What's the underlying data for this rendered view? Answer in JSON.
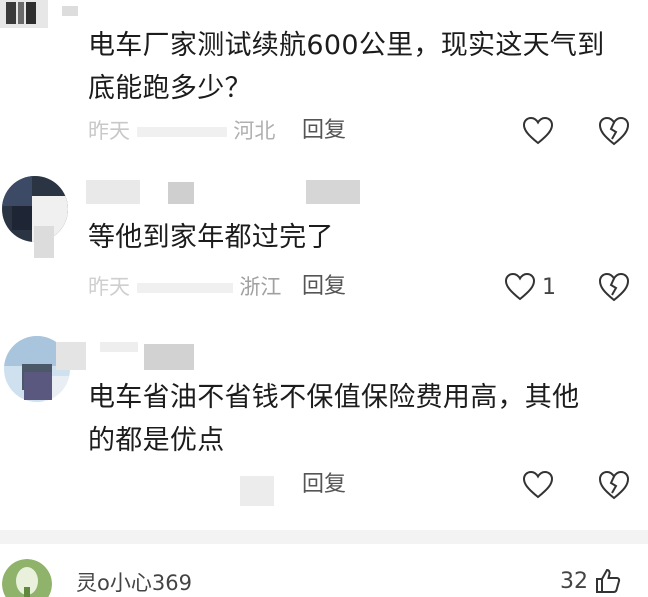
{
  "comments": [
    {
      "text_line1": "电车厂家测试续航600公里，现实这天气到",
      "text_line2": "底能跑多少？",
      "time": "昨天",
      "location": "河北",
      "reply_label": "回复",
      "like_count": ""
    },
    {
      "text_line1": "等他到家年都过完了",
      "time": "昨天",
      "location": "浙江",
      "reply_label": "回复",
      "like_count": "1"
    },
    {
      "text_line1": "电车省油不省钱不保值保险费用高，其他",
      "text_line2": "的都是优点",
      "reply_label": "回复",
      "like_count": ""
    }
  ],
  "bottom_comment": {
    "username": "灵o小心369",
    "like_count": "32"
  },
  "icons": {
    "like": "heart-outline-icon",
    "dislike": "broken-heart-icon",
    "thumb": "thumbs-up-icon"
  },
  "colors": {
    "text": "#1c1c1c",
    "meta": "#9a9a9a",
    "icon_stroke": "#333333",
    "divider": "#f3f3f3"
  }
}
